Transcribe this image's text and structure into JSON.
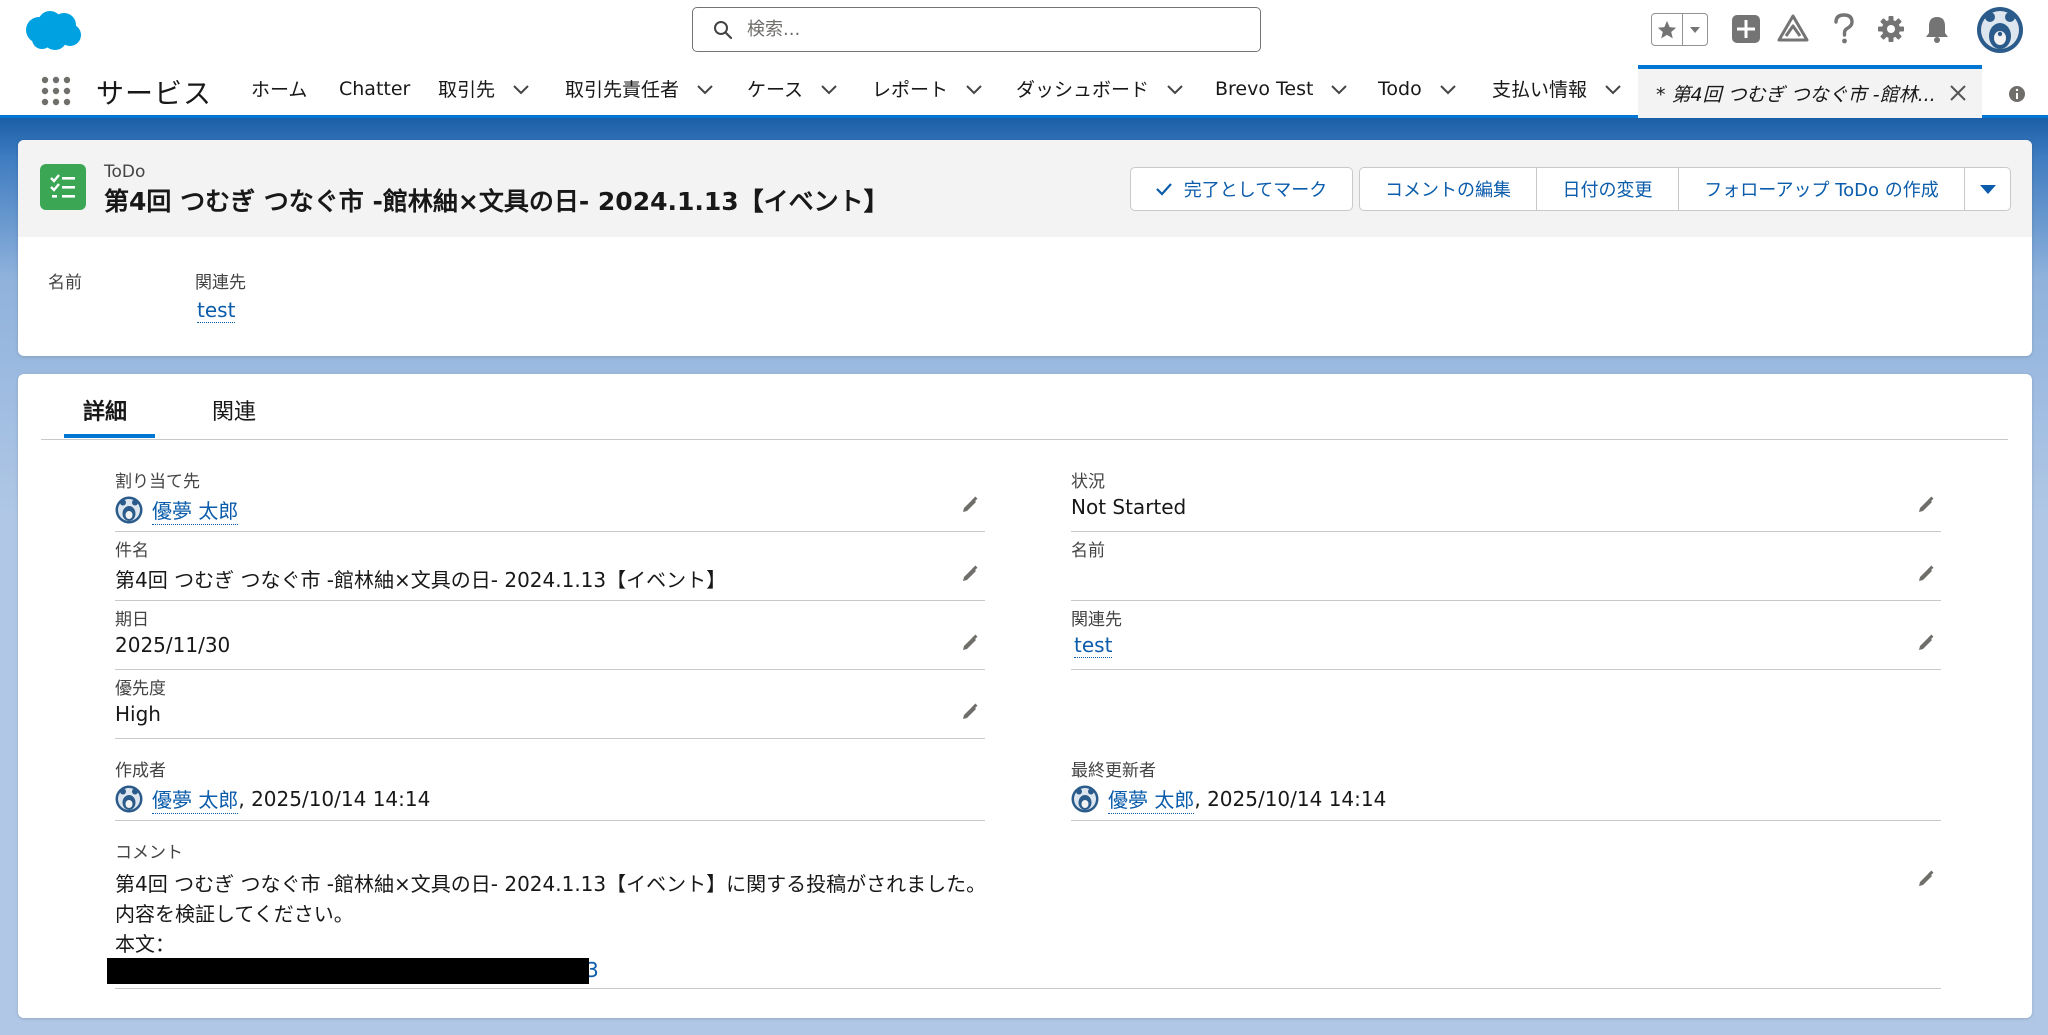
{
  "header": {
    "search_placeholder": "検索...",
    "icons": [
      "salesforce-cloud-logo",
      "search-icon",
      "favorites-star-icon",
      "favorites-caret-icon",
      "global-create-icon",
      "trailhead-icon",
      "help-icon",
      "setup-gear-icon",
      "notifications-bell-icon",
      "user-avatar"
    ]
  },
  "nav": {
    "app_name": "サービス",
    "items": [
      {
        "label": "ホーム"
      },
      {
        "label": "Chatter"
      },
      {
        "label": "取引先"
      },
      {
        "label": "取引先責任者"
      },
      {
        "label": "ケース"
      },
      {
        "label": "レポート"
      },
      {
        "label": "ダッシュボード"
      },
      {
        "label": "Brevo Test"
      },
      {
        "label": "Todo"
      },
      {
        "label": "支払い情報"
      }
    ],
    "active_tab": "* 第4回 つむぎ つなぐ市 -館林..."
  },
  "record": {
    "type": "ToDo",
    "title": "第4回 つむぎ つなぐ市 -館林紬×文具の日- 2024.1.13【イベント】",
    "buttons": {
      "mark_complete": "完了としてマーク",
      "edit_comments": "コメントの編集",
      "change_date": "日付の変更",
      "create_followup": "フォローアップ ToDo の作成"
    },
    "highlights": {
      "name_label": "名前",
      "related_label": "関連先",
      "related_value": "test"
    }
  },
  "tabs": {
    "details": "詳細",
    "related": "関連"
  },
  "fields": {
    "assigned_to": {
      "label": "割り当て先",
      "value": "優夢 太郎"
    },
    "status": {
      "label": "状況",
      "value": "Not Started"
    },
    "subject": {
      "label": "件名",
      "value": "第4回 つむぎ つなぐ市 -館林紬×文具の日- 2024.1.13【イベント】"
    },
    "name": {
      "label": "名前",
      "value": ""
    },
    "due_date": {
      "label": "期日",
      "value": "2025/11/30"
    },
    "related_to": {
      "label": "関連先",
      "value": "test"
    },
    "priority": {
      "label": "優先度",
      "value": "High"
    },
    "created_by": {
      "label": "作成者",
      "user": "優夢 太郎",
      "date": ", 2025/10/14 14:14"
    },
    "last_modified_by": {
      "label": "最終更新者",
      "user": "優夢 太郎",
      "date": ", 2025/10/14 14:14"
    },
    "comments": {
      "label": "コメント",
      "line1": "第4回 つむぎ つなぐ市 -館林紬×文具の日- 2024.1.13【イベント】に関する投稿がされました。",
      "line2": "内容を検証してください。",
      "line3": "本文：",
      "line4_tail": "3"
    }
  },
  "colors": {
    "brand": "#0176d3",
    "link": "#0b5cab",
    "task_icon": "#3ba755",
    "icon_gray": "#747474"
  }
}
